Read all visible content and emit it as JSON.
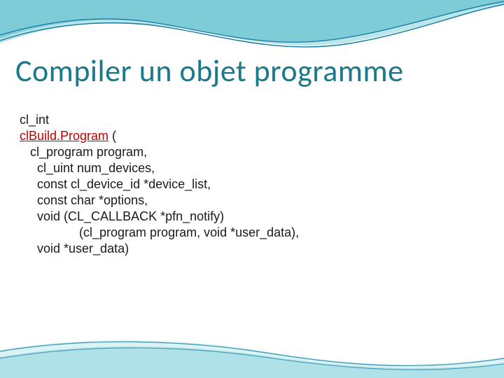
{
  "title": "Compiler un objet programme",
  "code": {
    "l0": "cl_int",
    "l1_fn": "clBuild.Program",
    "l1_rest": " (",
    "l2": "   cl_program program,",
    "l3": "     cl_uint num_devices,",
    "l4": "     const cl_device_id *device_list,",
    "l5": "     const char *options,",
    "l6": "     void (CL_CALLBACK *pfn_notify)",
    "l7": "                 (cl_program program, void *user_data),",
    "l8": "     void *user_data)"
  }
}
